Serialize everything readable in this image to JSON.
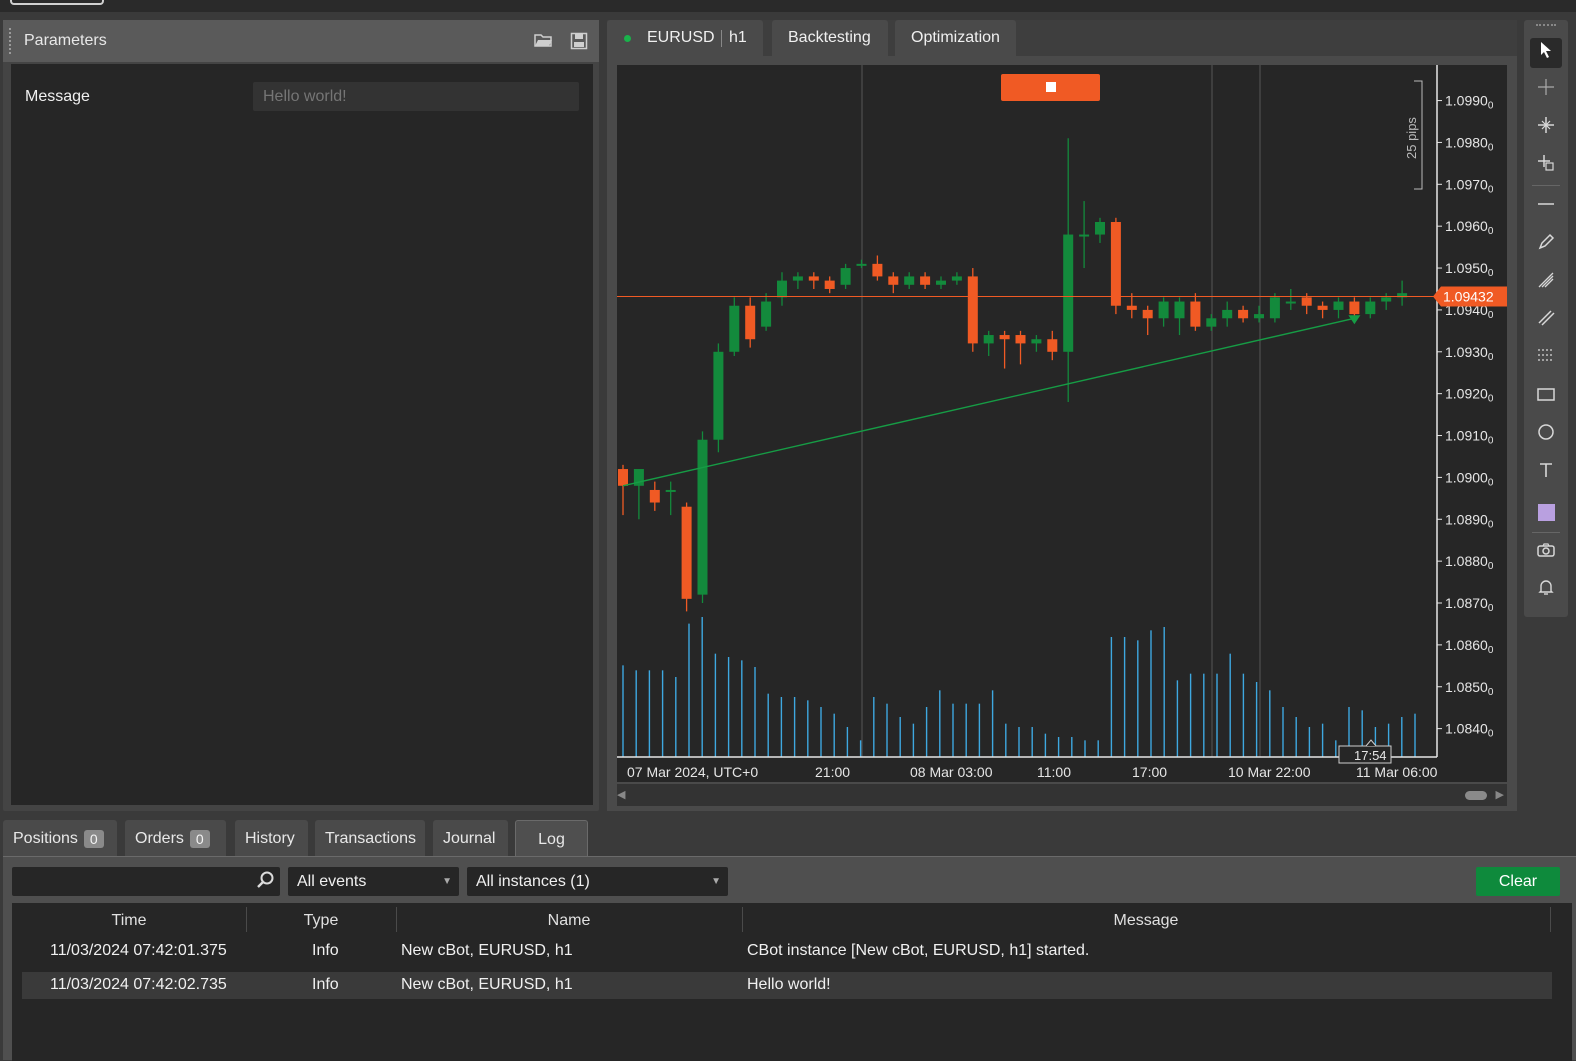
{
  "parameters_panel": {
    "title": "Parameters",
    "message_label": "Message",
    "message_value": "Hello world!"
  },
  "chart_panel": {
    "tabs": [
      {
        "label": "EURUSD",
        "timeframe": "h1"
      },
      {
        "label": "Backtesting"
      },
      {
        "label": "Optimization"
      }
    ],
    "pips_label": "25 pips",
    "current_price": "1.09432",
    "time_marker": "17:54",
    "colors": {
      "bull": "#138a3c",
      "bear": "#f05a24",
      "volume": "#3ea8e0",
      "price_line": "#f05a24",
      "trend": "#169c45"
    }
  },
  "chart_data": {
    "type": "candlestick",
    "symbol": "EURUSD",
    "timeframe": "h1",
    "y_ticks": [
      "1.0990",
      "1.0980",
      "1.0970",
      "1.0960",
      "1.0950",
      "1.0940",
      "1.0930",
      "1.0920",
      "1.0910",
      "1.0900",
      "1.0890",
      "1.0880",
      "1.0870",
      "1.0860",
      "1.0850",
      "1.0840"
    ],
    "y_tick_suffix": "0",
    "ylim": [
      1.0838,
      1.0993
    ],
    "x_ticks": [
      "07 Mar 2024, UTC+0",
      "21:00",
      "08 Mar 03:00",
      "11:00",
      "17:00",
      "10 Mar 22:00",
      "11 Mar 06:00"
    ],
    "current_price": 1.09432,
    "candles": [
      [
        1.0902,
        1.0898,
        1.0891,
        1.0903
      ],
      [
        1.0898,
        1.0902,
        1.089,
        1.0901
      ],
      [
        1.0897,
        1.0894,
        1.0892,
        1.0899
      ],
      [
        1.0897,
        1.0897,
        1.0891,
        1.0899
      ],
      [
        1.0893,
        1.0871,
        1.0868,
        1.0894
      ],
      [
        1.0872,
        1.0909,
        1.087,
        1.0911
      ],
      [
        1.0909,
        1.093,
        1.0906,
        1.0932
      ],
      [
        1.093,
        1.0941,
        1.0929,
        1.0943
      ],
      [
        1.0941,
        1.0933,
        1.0931,
        1.0943
      ],
      [
        1.0936,
        1.0942,
        1.0935,
        1.0944
      ],
      [
        1.0943,
        1.0947,
        1.0941,
        1.0949
      ],
      [
        1.0947,
        1.0948,
        1.0945,
        1.0949
      ],
      [
        1.0948,
        1.0947,
        1.0945,
        1.0949
      ],
      [
        1.0947,
        1.0945,
        1.0944,
        1.0948
      ],
      [
        1.0946,
        1.095,
        1.0945,
        1.0951
      ],
      [
        1.0951,
        1.0951,
        1.095,
        1.0952
      ],
      [
        1.0951,
        1.0948,
        1.0947,
        1.0953
      ],
      [
        1.0948,
        1.0946,
        1.0944,
        1.0949
      ],
      [
        1.0946,
        1.0948,
        1.0945,
        1.0949
      ],
      [
        1.0948,
        1.0946,
        1.0945,
        1.0949
      ],
      [
        1.0946,
        1.0947,
        1.0945,
        1.0948
      ],
      [
        1.0947,
        1.0948,
        1.0946,
        1.0949
      ],
      [
        1.0948,
        1.0932,
        1.093,
        1.095
      ],
      [
        1.0932,
        1.0934,
        1.0929,
        1.0935
      ],
      [
        1.0934,
        1.0933,
        1.0926,
        1.0935
      ],
      [
        1.0934,
        1.0932,
        1.0927,
        1.0935
      ],
      [
        1.0932,
        1.0933,
        1.093,
        1.0934
      ],
      [
        1.0933,
        1.093,
        1.0928,
        1.0935
      ],
      [
        1.093,
        1.0958,
        1.0918,
        1.0981
      ],
      [
        1.0958,
        1.0958,
        1.095,
        1.0966
      ],
      [
        1.0958,
        1.0961,
        1.0956,
        1.0962
      ],
      [
        1.0961,
        1.0941,
        1.0939,
        1.0962
      ],
      [
        1.0941,
        1.094,
        1.0938,
        1.0944
      ],
      [
        1.094,
        1.0938,
        1.0934,
        1.0941
      ],
      [
        1.0938,
        1.0942,
        1.0936,
        1.0943
      ],
      [
        1.0938,
        1.0942,
        1.0934,
        1.0943
      ],
      [
        1.0942,
        1.0936,
        1.0935,
        1.0944
      ],
      [
        1.0936,
        1.0938,
        1.0935,
        1.0939
      ],
      [
        1.0938,
        1.094,
        1.0936,
        1.0942
      ],
      [
        1.094,
        1.0938,
        1.0937,
        1.0941
      ],
      [
        1.0938,
        1.0939,
        1.0937,
        1.0941
      ],
      [
        1.0938,
        1.0943,
        1.0937,
        1.0944
      ],
      [
        1.0942,
        1.0942,
        1.094,
        1.0945
      ],
      [
        1.0943,
        1.0941,
        1.0939,
        1.0944
      ],
      [
        1.0941,
        1.094,
        1.0938,
        1.0942
      ],
      [
        1.094,
        1.0942,
        1.0938,
        1.0943
      ],
      [
        1.0942,
        1.0939,
        1.0938,
        1.0943
      ],
      [
        1.0939,
        1.0942,
        1.0938,
        1.0943
      ],
      [
        1.0942,
        1.0943,
        1.094,
        1.0944
      ],
      [
        1.0943,
        1.0944,
        1.0941,
        1.0947
      ]
    ],
    "volumes": [
      55,
      52,
      52,
      52,
      48,
      80,
      84,
      62,
      60,
      58,
      54,
      38,
      36,
      36,
      34,
      30,
      26,
      18,
      10,
      36,
      32,
      24,
      20,
      30,
      40,
      32,
      32,
      32,
      40,
      20,
      18,
      18,
      14,
      12,
      12,
      10,
      10,
      72,
      72,
      70,
      76,
      78,
      46,
      50,
      50,
      50,
      62,
      50,
      45,
      40,
      30,
      24,
      18,
      20,
      10,
      30,
      28,
      18,
      20,
      24,
      26
    ],
    "trend_line": {
      "from_index": 0,
      "from_price": 1.0898,
      "to_index": 46,
      "to_price": 1.0938
    },
    "vertical_markers": [
      "21:00",
      "11:00",
      "10 Mar 22:00"
    ]
  },
  "toolbar": {
    "icons": [
      "cursor-icon",
      "crosshair-icon",
      "zoom-icon",
      "add-icon",
      "horizontal-line-icon",
      "pencil-icon",
      "fibonacci-icon",
      "channel-icon",
      "grid-icon",
      "rectangle-icon",
      "ellipse-icon",
      "text-icon",
      "color-swatch-icon",
      "camera-icon",
      "bell-icon"
    ],
    "swatch_color": "#b9a0e0"
  },
  "bottom_tabs": {
    "positions_label": "Positions",
    "positions_count": "0",
    "orders_label": "Orders",
    "orders_count": "0",
    "history_label": "History",
    "transactions_label": "Transactions",
    "journal_label": "Journal",
    "log_label": "Log"
  },
  "log": {
    "search_placeholder": "",
    "events_filter": "All events",
    "instances_filter": "All instances (1)",
    "clear_label": "Clear",
    "columns": [
      "Time",
      "Type",
      "Name",
      "Message"
    ],
    "rows": [
      {
        "time": "11/03/2024 07:42:01.375",
        "type": "Info",
        "name": "New cBot, EURUSD, h1",
        "message": "CBot instance [New cBot, EURUSD, h1] started."
      },
      {
        "time": "11/03/2024 07:42:02.735",
        "type": "Info",
        "name": "New cBot, EURUSD, h1",
        "message": "Hello world!"
      }
    ]
  }
}
